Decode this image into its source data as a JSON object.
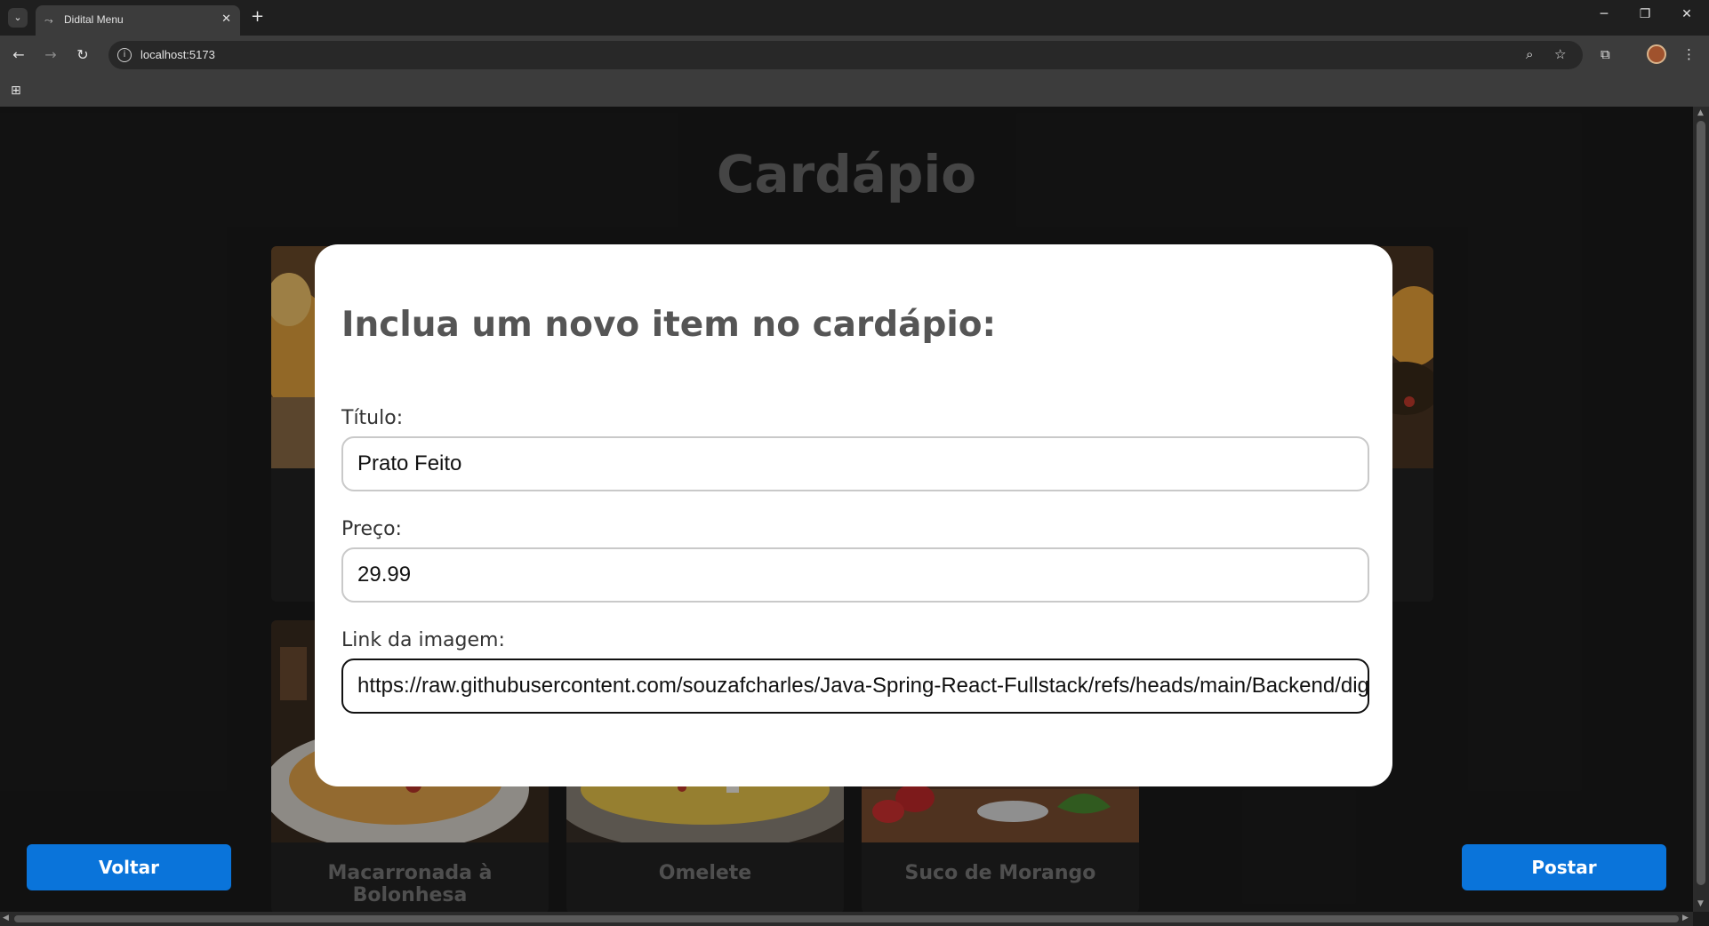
{
  "browser": {
    "tab_title": "Didital Menu",
    "url": "localhost:5173"
  },
  "page": {
    "title": "Cardápio",
    "cards": [
      {
        "label": ""
      },
      {
        "label": ""
      },
      {
        "label": "Macarronada à Bolonhesa"
      },
      {
        "label": "Omelete"
      },
      {
        "label": "Suco de Morango"
      }
    ],
    "buttons": {
      "back_label": "Voltar",
      "post_label": "Postar"
    }
  },
  "modal": {
    "title": "Inclua um novo item no cardápio:",
    "fields": {
      "title_label": "Título:",
      "title_value": "Prato Feito",
      "price_label": "Preço:",
      "price_value": "29.99",
      "image_label": "Link da imagem:",
      "image_value": "https://raw.githubusercontent.com/souzafcharles/Java-Spring-React-Fullstack/refs/heads/main/Backend/digitalMe"
    }
  },
  "colors": {
    "accent": "#0a74da",
    "page_bg": "#1b1b1b",
    "modal_bg": "#ffffff"
  }
}
